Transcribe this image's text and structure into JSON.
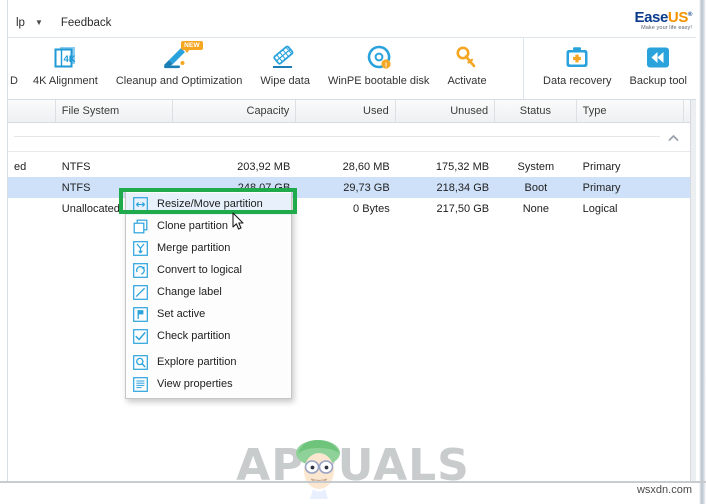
{
  "app": {
    "brand": {
      "name_part1": "Ease",
      "name_part2": "US",
      "registered": "®",
      "tagline": "Make your life easy!"
    }
  },
  "menubar": {
    "items": [
      {
        "label": "lp",
        "name": "menu-help"
      },
      {
        "label": "▼",
        "name": "menu-dropdown-caret"
      },
      {
        "label": "Feedback",
        "name": "menu-feedback"
      }
    ]
  },
  "toolbar": {
    "left_items": [
      {
        "label": "D",
        "icon": "clipped-icon"
      },
      {
        "label": "4K Alignment",
        "icon": "4k-alignment-icon"
      },
      {
        "label": "Cleanup and Optimization",
        "icon": "cleanup-icon",
        "badge": "NEW"
      },
      {
        "label": "Wipe data",
        "icon": "eraser-icon"
      },
      {
        "label": "WinPE bootable disk",
        "icon": "disc-icon"
      },
      {
        "label": "Activate",
        "icon": "key-icon"
      }
    ],
    "right_items": [
      {
        "label": "Data recovery",
        "icon": "first-aid-kit-icon"
      },
      {
        "label": "Backup tool",
        "icon": "backup-diamond-icon"
      }
    ]
  },
  "table": {
    "headers": [
      {
        "label": "",
        "align": "l",
        "key": "name"
      },
      {
        "label": "File System",
        "align": "l",
        "key": "fs"
      },
      {
        "label": "Capacity",
        "align": "r",
        "key": "capacity"
      },
      {
        "label": "Used",
        "align": "r",
        "key": "used"
      },
      {
        "label": "Unused",
        "align": "r",
        "key": "unused"
      },
      {
        "label": "Status",
        "align": "c",
        "key": "status"
      },
      {
        "label": "Type",
        "align": "l",
        "key": "type"
      }
    ],
    "rows": [
      {
        "name": "ed",
        "fs": "NTFS",
        "capacity": "203,92 MB",
        "used": "28,60 MB",
        "unused": "175,32 MB",
        "status": "System",
        "type": "Primary",
        "selected": false
      },
      {
        "name": "",
        "fs": "NTFS",
        "capacity": "248,07 GB",
        "used": "29,73 GB",
        "unused": "218,34 GB",
        "status": "Boot",
        "type": "Primary",
        "selected": true
      },
      {
        "name": "",
        "fs": "Unallocated",
        "capacity": "",
        "used": "0 Bytes",
        "unused": "217,50 GB",
        "status": "None",
        "type": "Logical",
        "selected": false
      }
    ]
  },
  "context_menu": {
    "items": [
      {
        "label": "Resize/Move partition",
        "icon": "resize-arrows-icon",
        "highlighted": true
      },
      {
        "label": "Clone partition",
        "icon": "clone-squares-icon",
        "highlighted": false
      },
      {
        "label": "Merge partition",
        "icon": "merge-arrow-icon",
        "highlighted": false
      },
      {
        "label": "Convert to logical",
        "icon": "convert-circular-arrow-icon",
        "highlighted": false
      },
      {
        "label": "Change label",
        "icon": "pencil-line-icon",
        "highlighted": false
      },
      {
        "label": "Set active",
        "icon": "flag-icon",
        "highlighted": false
      },
      {
        "label": "Check partition",
        "icon": "checkmark-icon",
        "highlighted": false
      },
      {
        "label": "Explore partition",
        "icon": "magnifier-icon",
        "highlighted": false
      },
      {
        "label": "View properties",
        "icon": "document-lines-icon",
        "highlighted": false
      }
    ]
  },
  "annotation": {
    "highlight_color": "#1faa4b"
  },
  "watermark": {
    "text": "APPUALS"
  },
  "footer": {
    "site": "wsxdn.com"
  }
}
